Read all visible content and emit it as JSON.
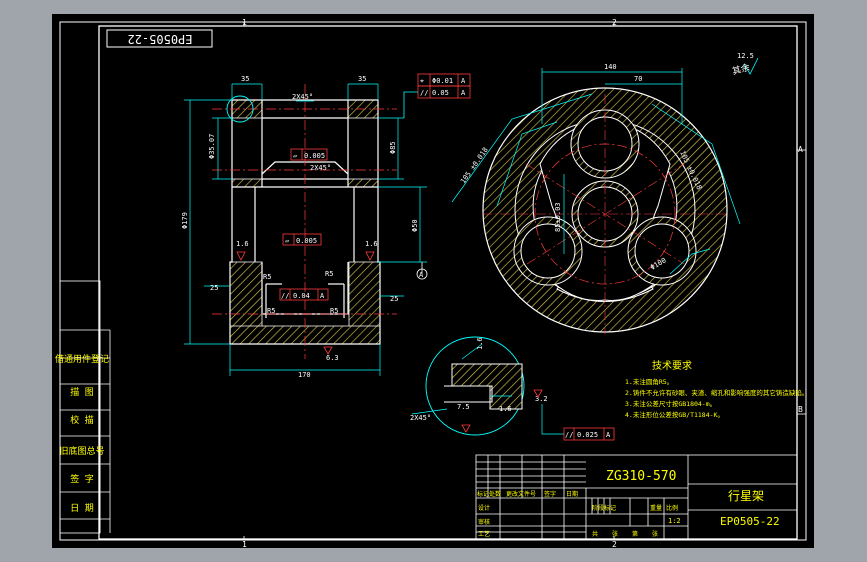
{
  "drawing_number_rotated": "EP0505-22",
  "drawing_number": "EP0505-22",
  "material": "ZG310-570",
  "part_name": "行星架",
  "scale": "1:2",
  "grid": {
    "top_1": "1",
    "top_2": "2",
    "bottom_1": "1",
    "bottom_2": "2",
    "right_a": "A",
    "right_b": "B"
  },
  "roughness": {
    "rest": "12.5",
    "rest_label": "其余"
  },
  "front_view": {
    "dim_35_left": "35",
    "dim_35_right": "35",
    "dim_2x45_top": "2X45°",
    "dim_2x45_mid": "2X45°",
    "dim_phi_left_small": "Φ35.07",
    "dim_phi_179": "Φ179",
    "dim_phi_right_small": "Φ85",
    "dim_phi_right_mid": "Φ50",
    "dim_25_left": "25",
    "dim_25_right": "25",
    "dim_r5_left": "R5",
    "dim_r5_right": "R5",
    "dim_r5_b_left": "R5",
    "dim_r5_b_right": "R5",
    "dim_170": "170",
    "rough_16_left": "1.6",
    "rough_16_right": "1.6",
    "rough_63": "6.3",
    "datum_a": "A"
  },
  "tolerances": {
    "pos_sym": "⌖",
    "pos_val": "Φ0.01",
    "pos_ref": "A",
    "par_sym": "//",
    "par_val": "0.05",
    "par_ref": "A",
    "flat1_sym": "▱",
    "flat1_val": "0.005",
    "flat2_sym": "▱",
    "flat2_val": "0.005",
    "par2_sym": "//",
    "par2_val": "0.04",
    "par2_ref": "A",
    "par3_sym": "//",
    "par3_val": "0.025",
    "par3_ref": "A"
  },
  "plan_view": {
    "dim_140": "140",
    "dim_70": "70",
    "dim_arc_left": "105 ±0.018",
    "dim_arc_right": "105 ±0.018",
    "dim_center": "85±0.03",
    "dim_phi_small": "Φ100"
  },
  "detail_view": {
    "dim_2x45": "2X45°",
    "rough_75": "7.5",
    "rough_16": "1.6",
    "rough_32": "3.2",
    "rough_16b": "1.6"
  },
  "tech_req": {
    "title": "技术要求",
    "lines": [
      "1.未注圆角R5。",
      "2.铸件不允许有砂眼、夹渣、缩孔和影响强度的其它铸造缺陷。",
      "3.未注公差尺寸按GB1804-m。",
      "4.未注形位公差按GB/T1184-K。"
    ]
  },
  "left_stamps": [
    "借通用件登记",
    "描 图",
    "校 描",
    "旧底图总号",
    "签 字",
    "日 期"
  ],
  "title_block_labels": [
    "标记",
    "处数",
    "更改文件号",
    "签字",
    "日期",
    "设计",
    "审核",
    "工艺",
    "阶段标记",
    "重量",
    "比例",
    "共",
    "张",
    "第",
    "张"
  ]
}
